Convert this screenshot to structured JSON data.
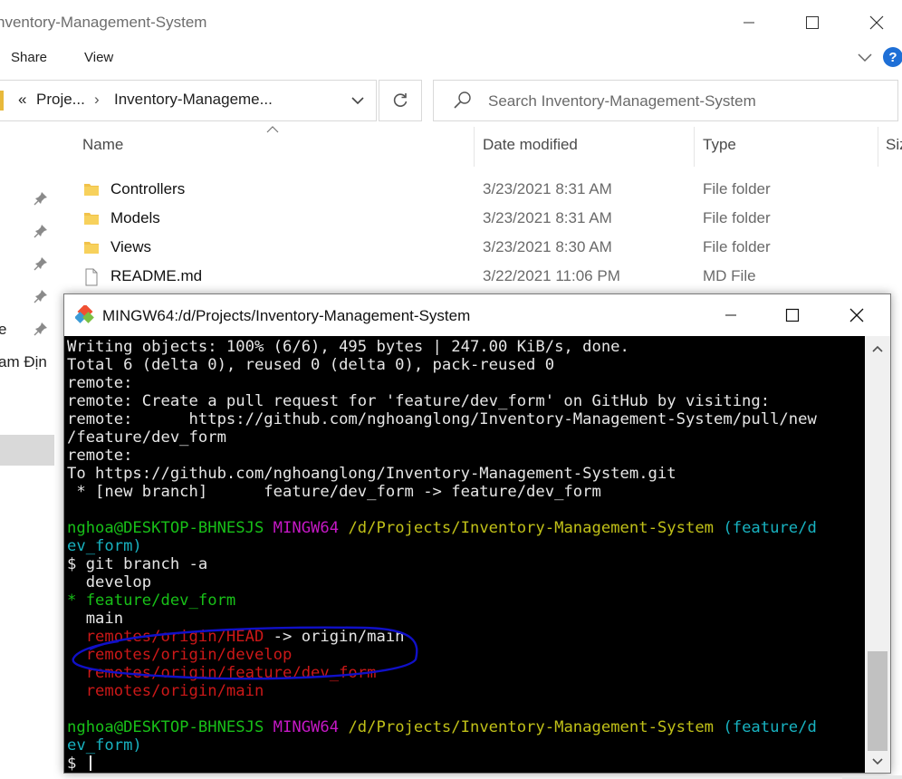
{
  "explorer": {
    "title": "nventory-Management-System",
    "ribbon_tabs": [
      "Share",
      "View"
    ],
    "help_label": "?",
    "address": {
      "overflow": "«",
      "crumb1": "Proje...",
      "separator": "›",
      "crumb2": "Inventory-Manageme..."
    },
    "search": {
      "placeholder": "Search Inventory-Management-System"
    },
    "columns": {
      "name": "Name",
      "date": "Date modified",
      "type": "Type",
      "size": "Siz"
    },
    "nav_labels": {
      "item_e": "e",
      "item_am": "am Địn"
    },
    "files": [
      {
        "name": "Controllers",
        "date": "3/23/2021 8:31 AM",
        "type": "File folder",
        "kind": "folder"
      },
      {
        "name": "Models",
        "date": "3/23/2021 8:31 AM",
        "type": "File folder",
        "kind": "folder"
      },
      {
        "name": "Views",
        "date": "3/23/2021 8:30 AM",
        "type": "File folder",
        "kind": "folder"
      },
      {
        "name": "README.md",
        "date": "3/22/2021 11:06 PM",
        "type": "MD File",
        "kind": "file"
      }
    ]
  },
  "terminal": {
    "title": "MINGW64:/d/Projects/Inventory-Management-System",
    "lines": [
      [
        {
          "t": "Writing objects: 100% (6/6), 495 bytes | 247.00 KiB/s, done.",
          "c": "white"
        }
      ],
      [
        {
          "t": "Total 6 (delta 0), reused 0 (delta 0), pack-reused 0",
          "c": "white"
        }
      ],
      [
        {
          "t": "remote:",
          "c": "white"
        }
      ],
      [
        {
          "t": "remote: Create a pull request for 'feature/dev_form' on GitHub by visiting:",
          "c": "white"
        }
      ],
      [
        {
          "t": "remote:      https://github.com/nghoanglong/Inventory-Management-System/pull/new",
          "c": "white"
        }
      ],
      [
        {
          "t": "/feature/dev_form",
          "c": "white"
        }
      ],
      [
        {
          "t": "remote:",
          "c": "white"
        }
      ],
      [
        {
          "t": "To https://github.com/nghoanglong/Inventory-Management-System.git",
          "c": "white"
        }
      ],
      [
        {
          "t": " * [new branch]      feature/dev_form -> feature/dev_form",
          "c": "white"
        }
      ],
      [
        {
          "t": "",
          "c": "white"
        }
      ],
      [
        {
          "t": "nghoa@DESKTOP-BHNESJS ",
          "c": "green"
        },
        {
          "t": "MINGW64 ",
          "c": "magenta"
        },
        {
          "t": "/d/Projects/Inventory-Management-System ",
          "c": "yellow"
        },
        {
          "t": "(feature/d",
          "c": "cyan"
        }
      ],
      [
        {
          "t": "ev_form)",
          "c": "cyan"
        }
      ],
      [
        {
          "t": "$ git branch -a",
          "c": "white"
        }
      ],
      [
        {
          "t": "  develop",
          "c": "white"
        }
      ],
      [
        {
          "t": "* ",
          "c": "green"
        },
        {
          "t": "feature/dev_form",
          "c": "green"
        }
      ],
      [
        {
          "t": "  main",
          "c": "white"
        }
      ],
      [
        {
          "t": "  remotes/origin/HEAD",
          "c": "red"
        },
        {
          "t": " -> origin/main",
          "c": "white"
        }
      ],
      [
        {
          "t": "  remotes/origin/develop",
          "c": "red"
        }
      ],
      [
        {
          "t": "  remotes/origin/feature/dev_form",
          "c": "red"
        }
      ],
      [
        {
          "t": "  remotes/origin/main",
          "c": "red"
        }
      ],
      [
        {
          "t": "",
          "c": "white"
        }
      ],
      [
        {
          "t": "nghoa@DESKTOP-BHNESJS ",
          "c": "green"
        },
        {
          "t": "MINGW64 ",
          "c": "magenta"
        },
        {
          "t": "/d/Projects/Inventory-Management-System ",
          "c": "yellow"
        },
        {
          "t": "(feature/d",
          "c": "cyan"
        }
      ],
      [
        {
          "t": "ev_form)",
          "c": "cyan"
        }
      ],
      [
        {
          "t": "$ ",
          "c": "white"
        }
      ]
    ]
  },
  "colors": {
    "annotation": "#1010c8",
    "prompt_user": "#18c018",
    "prompt_host": "#c518c5",
    "prompt_path": "#c0c018",
    "prompt_branch": "#18b2c0",
    "remote_branch": "#cc1818"
  },
  "icons": [
    "folder-icon",
    "file-icon",
    "pin-icon",
    "search-icon",
    "refresh-icon",
    "chevron-down-icon",
    "help-icon",
    "minimize-icon",
    "maximize-icon",
    "close-icon",
    "mingw-icon",
    "scroll-up-icon",
    "scroll-down-icon"
  ]
}
